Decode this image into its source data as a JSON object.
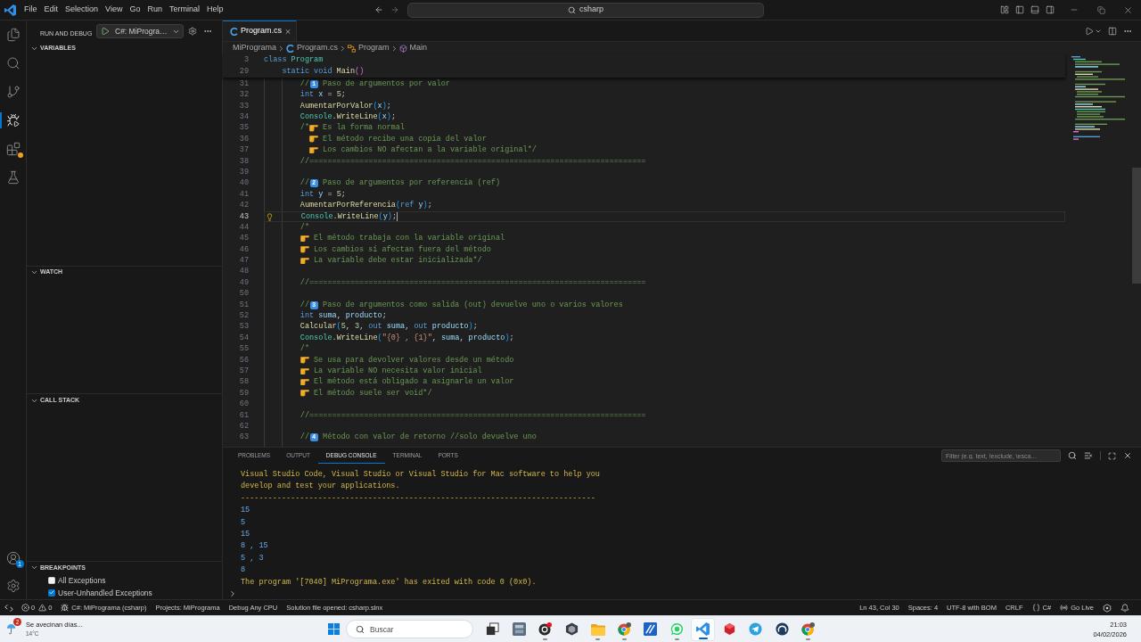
{
  "title_bar": {
    "menu": [
      "File",
      "Edit",
      "Selection",
      "View",
      "Go",
      "Run",
      "Terminal",
      "Help"
    ],
    "command_center": {
      "label": "csharp"
    }
  },
  "activity_bar": {
    "items": [
      {
        "kind": "files",
        "selected": false,
        "warning": false
      },
      {
        "kind": "search",
        "selected": false,
        "warning": false
      },
      {
        "kind": "source-control",
        "selected": false,
        "warning": false
      },
      {
        "kind": "debug",
        "selected": true,
        "warning": false
      },
      {
        "kind": "extensions",
        "selected": false,
        "warning": true
      },
      {
        "kind": "testing",
        "selected": false,
        "warning": false
      }
    ],
    "bottom": [
      {
        "kind": "account",
        "badge": "1"
      },
      {
        "kind": "settings"
      }
    ]
  },
  "sidebar": {
    "title": "RUN AND DEBUG",
    "launch_config": "C#: MiProgra…",
    "sections": [
      {
        "title": "VARIABLES",
        "expanded": true
      },
      {
        "title": "WATCH",
        "expanded": true
      },
      {
        "title": "CALL STACK",
        "expanded": true
      },
      {
        "title": "BREAKPOINTS",
        "expanded": true,
        "items": [
          {
            "label": "All Exceptions",
            "checked": false
          },
          {
            "label": "User-Unhandled Exceptions",
            "checked": true
          }
        ]
      }
    ]
  },
  "editor": {
    "tabs": [
      {
        "label": "Program.cs",
        "selected": true
      }
    ],
    "breadcrumb": [
      {
        "kind": "folder",
        "label": "MiPrograma"
      },
      {
        "kind": "file",
        "label": "Program.cs"
      },
      {
        "kind": "class",
        "label": "Program"
      },
      {
        "kind": "method",
        "label": "Main"
      }
    ],
    "sticky_lines": [
      {
        "number": "3",
        "code": [
          {
            "kind": "keyword",
            "text": "class"
          },
          {
            "kind": "type",
            "text": " Program"
          }
        ],
        "children": [
          {
            "number": "29",
            "code": [
              {
                "kind": "keyword",
                "text": "static"
              },
              {
                "kind": "keyword",
                "text": " void"
              },
              {
                "kind": "method",
                "text": " Main"
              },
              {
                "kind": "bracket2",
                "text": "()"
              }
            ]
          }
        ]
      }
    ],
    "lines": [
      {
        "number": "31",
        "current": false,
        "code": [
          {
            "kind": "comment",
            "text": "//"
          },
          {
            "kind": "keycap",
            "text": "1"
          },
          {
            "kind": "comment",
            "text": " Paso de argumentos por valor"
          }
        ]
      },
      {
        "number": "32",
        "current": false,
        "code": [
          {
            "kind": "keyword",
            "text": "int"
          },
          {
            "kind": "variable",
            "text": " x"
          },
          {
            "kind": "punct",
            "text": " = "
          },
          {
            "kind": "number",
            "text": "5"
          },
          {
            "kind": "punct",
            "text": ";"
          }
        ]
      },
      {
        "number": "33",
        "current": false,
        "code": [
          {
            "kind": "method",
            "text": "AumentarPorValor"
          },
          {
            "kind": "bracket3",
            "text": "("
          },
          {
            "kind": "variable",
            "text": "x"
          },
          {
            "kind": "bracket3",
            "text": ")"
          },
          {
            "kind": "punct",
            "text": ";"
          }
        ]
      },
      {
        "number": "34",
        "current": false,
        "code": [
          {
            "kind": "type",
            "text": "Console"
          },
          {
            "kind": "punct",
            "text": "."
          },
          {
            "kind": "method",
            "text": "WriteLine"
          },
          {
            "kind": "bracket3",
            "text": "("
          },
          {
            "kind": "variable",
            "text": "x"
          },
          {
            "kind": "bracket3",
            "text": ")"
          },
          {
            "kind": "punct",
            "text": ";"
          }
        ]
      },
      {
        "number": "35",
        "current": false,
        "code": [
          {
            "kind": "comment",
            "text": "/*"
          },
          {
            "kind": "hand"
          },
          {
            "kind": "comment",
            "text": " Es la forma normal"
          }
        ],
        "children": [
          {
            "number": "36",
            "current": false,
            "code": [
              {
                "kind": "hand"
              },
              {
                "kind": "comment",
                "text": " El método recibe una copia del valor"
              }
            ]
          },
          {
            "number": "37",
            "current": false,
            "code": [
              {
                "kind": "hand"
              },
              {
                "kind": "comment",
                "text": " Los cambios NO afectan a la variable original*/"
              }
            ]
          }
        ]
      },
      {
        "number": "38",
        "current": false,
        "code": [
          {
            "kind": "comment",
            "text": "//=========================================================================="
          }
        ]
      },
      {
        "number": "39",
        "current": false
      },
      {
        "number": "40",
        "current": false,
        "code": [
          {
            "kind": "comment",
            "text": "//"
          },
          {
            "kind": "keycap",
            "text": "2"
          },
          {
            "kind": "comment",
            "text": " Paso de argumentos por referencia (ref)"
          }
        ]
      },
      {
        "number": "41",
        "current": false,
        "code": [
          {
            "kind": "keyword",
            "text": "int"
          },
          {
            "kind": "variable",
            "text": " y"
          },
          {
            "kind": "punct",
            "text": " = "
          },
          {
            "kind": "number",
            "text": "5"
          },
          {
            "kind": "punct",
            "text": ";"
          }
        ]
      },
      {
        "number": "42",
        "current": false,
        "code": [
          {
            "kind": "method",
            "text": "AumentarPorReferencia"
          },
          {
            "kind": "bracket3",
            "text": "("
          },
          {
            "kind": "keyword",
            "text": "ref"
          },
          {
            "kind": "variable",
            "text": " y"
          },
          {
            "kind": "bracket3",
            "text": ")"
          },
          {
            "kind": "punct",
            "text": ";"
          }
        ]
      },
      {
        "number": "43",
        "current": true,
        "code": [
          {
            "kind": "type",
            "text": "Console"
          },
          {
            "kind": "punct",
            "text": "."
          },
          {
            "kind": "method",
            "text": "WriteLine"
          },
          {
            "kind": "bracket3",
            "text": "("
          },
          {
            "kind": "variable",
            "text": "y"
          },
          {
            "kind": "bracket3",
            "text": ")"
          },
          {
            "kind": "punct",
            "text": ";"
          }
        ]
      },
      {
        "number": "44",
        "current": false,
        "code": [
          {
            "kind": "comment",
            "text": "/*"
          }
        ]
      },
      {
        "number": "45",
        "current": false,
        "code": [
          {
            "kind": "hand"
          },
          {
            "kind": "comment",
            "text": " El método trabaja con la variable original"
          }
        ]
      },
      {
        "number": "46",
        "current": false,
        "code": [
          {
            "kind": "hand"
          },
          {
            "kind": "comment",
            "text": " Los cambios sí afectan fuera del método"
          }
        ]
      },
      {
        "number": "47",
        "current": false,
        "code": [
          {
            "kind": "hand"
          },
          {
            "kind": "comment",
            "text": " La variable debe estar inicializada*/"
          }
        ]
      },
      {
        "number": "48",
        "current": false
      },
      {
        "number": "49",
        "current": false,
        "code": [
          {
            "kind": "comment",
            "text": "//=========================================================================="
          }
        ]
      },
      {
        "number": "50",
        "current": false
      },
      {
        "number": "51",
        "current": false,
        "code": [
          {
            "kind": "comment",
            "text": "//"
          },
          {
            "kind": "keycap",
            "text": "3"
          },
          {
            "kind": "comment",
            "text": " Paso de argumentos como salida (out) devuelve uno o varios valores"
          }
        ]
      },
      {
        "number": "52",
        "current": false,
        "code": [
          {
            "kind": "keyword",
            "text": "int"
          },
          {
            "kind": "variable",
            "text": " suma"
          },
          {
            "kind": "punct",
            "text": ", "
          },
          {
            "kind": "variable",
            "text": "producto"
          },
          {
            "kind": "punct",
            "text": ";"
          }
        ]
      },
      {
        "number": "53",
        "current": false,
        "code": [
          {
            "kind": "method",
            "text": "Calcular"
          },
          {
            "kind": "bracket3",
            "text": "("
          },
          {
            "kind": "number",
            "text": "5"
          },
          {
            "kind": "punct",
            "text": ", "
          },
          {
            "kind": "number",
            "text": "3"
          },
          {
            "kind": "punct",
            "text": ", "
          },
          {
            "kind": "keyword",
            "text": "out"
          },
          {
            "kind": "variable",
            "text": " suma"
          },
          {
            "kind": "punct",
            "text": ", "
          },
          {
            "kind": "keyword",
            "text": "out"
          },
          {
            "kind": "variable",
            "text": " producto"
          },
          {
            "kind": "bracket3",
            "text": ")"
          },
          {
            "kind": "punct",
            "text": ";"
          }
        ]
      },
      {
        "number": "54",
        "current": false,
        "code": [
          {
            "kind": "type",
            "text": "Console"
          },
          {
            "kind": "punct",
            "text": "."
          },
          {
            "kind": "method",
            "text": "WriteLine"
          },
          {
            "kind": "bracket3",
            "text": "("
          },
          {
            "kind": "string",
            "text": "\"{0} , {1}\""
          },
          {
            "kind": "punct",
            "text": ", "
          },
          {
            "kind": "variable",
            "text": "suma"
          },
          {
            "kind": "punct",
            "text": ", "
          },
          {
            "kind": "variable",
            "text": "producto"
          },
          {
            "kind": "bracket3",
            "text": ")"
          },
          {
            "kind": "punct",
            "text": ";"
          }
        ]
      },
      {
        "number": "55",
        "current": false,
        "code": [
          {
            "kind": "comment",
            "text": "/*"
          }
        ]
      },
      {
        "number": "56",
        "current": false,
        "code": [
          {
            "kind": "hand"
          },
          {
            "kind": "comment",
            "text": " Se usa para devolver valores desde un método"
          }
        ]
      },
      {
        "number": "57",
        "current": false,
        "code": [
          {
            "kind": "hand"
          },
          {
            "kind": "comment",
            "text": " La variable NO necesita valor inicial"
          }
        ]
      },
      {
        "number": "58",
        "current": false,
        "code": [
          {
            "kind": "hand"
          },
          {
            "kind": "comment",
            "text": " El método está obligado a asignarle un valor"
          }
        ]
      },
      {
        "number": "59",
        "current": false,
        "code": [
          {
            "kind": "hand"
          },
          {
            "kind": "comment",
            "text": " El método suele ser void*/"
          }
        ]
      },
      {
        "number": "60",
        "current": false
      },
      {
        "number": "61",
        "current": false,
        "code": [
          {
            "kind": "comment",
            "text": "//=========================================================================="
          }
        ]
      },
      {
        "number": "62",
        "current": false
      },
      {
        "number": "63",
        "current": false,
        "code": [
          {
            "kind": "comment",
            "text": "//"
          },
          {
            "kind": "keycap",
            "text": "4"
          },
          {
            "kind": "comment",
            "text": " Método con valor de retorno //solo devuelve uno"
          }
        ]
      }
    ]
  },
  "panel": {
    "tabs": [
      {
        "label": "PROBLEMS",
        "selected": false
      },
      {
        "label": "OUTPUT",
        "selected": false
      },
      {
        "label": "DEBUG CONSOLE",
        "selected": true
      },
      {
        "label": "TERMINAL",
        "selected": false
      },
      {
        "label": "PORTS",
        "selected": false
      }
    ],
    "filter": {
      "placeholder": "Filter (e.g. text, !exclude, \\esca…"
    },
    "console": [
      {
        "kind": "info",
        "text": "Visual Studio Code, Visual Studio or Visual Studio for Mac software to help you"
      },
      {
        "kind": "info",
        "text": "develop and test your applications."
      },
      {
        "kind": "info",
        "text": "------------------------------------------------------------------------------"
      },
      {
        "kind": "stdout",
        "text": "15"
      },
      {
        "kind": "stdout",
        "text": "5"
      },
      {
        "kind": "stdout",
        "text": "15"
      },
      {
        "kind": "stdout",
        "text": "8 , 15"
      },
      {
        "kind": "stdout",
        "text": "5 , 3"
      },
      {
        "kind": "stdout",
        "text": "8"
      },
      {
        "kind": "info",
        "text": "The program '[7040] MiPrograma.exe' has exited with code 0 (0x0)."
      }
    ]
  },
  "status_bar": {
    "left": [
      {
        "kind": "remote"
      },
      {
        "kind": "problems",
        "errors": "0",
        "warnings": "0"
      },
      {
        "kind": "debug",
        "label": "C#: MiPrograma (csharp)"
      },
      {
        "kind": "text",
        "label": "Projects: MiPrograma"
      },
      {
        "kind": "text",
        "label": "Debug Any CPU"
      },
      {
        "kind": "text",
        "label": "Solution file opened: csharp.slnx"
      }
    ],
    "right": [
      {
        "kind": "text",
        "label": "Ln 43, Col 30"
      },
      {
        "kind": "text",
        "label": "Spaces: 4"
      },
      {
        "kind": "text",
        "label": "UTF-8 with BOM"
      },
      {
        "kind": "text",
        "label": "CRLF"
      },
      {
        "kind": "language",
        "label": "C#"
      },
      {
        "kind": "live",
        "label": "Go Live"
      },
      {
        "kind": "extension"
      },
      {
        "kind": "bell"
      }
    ]
  },
  "taskbar": {
    "weather": {
      "badge": "2",
      "headline": "Se avecinan días...",
      "temperature": "14°C"
    },
    "search": {
      "placeholder": "Buscar"
    },
    "apps": [
      {
        "kind": "task-view",
        "running": false,
        "selected": false
      },
      {
        "kind": "tile",
        "running": false,
        "selected": false
      },
      {
        "kind": "dark-circle",
        "running": true,
        "selected": false
      },
      {
        "kind": "cube",
        "running": false,
        "selected": false
      },
      {
        "kind": "folder",
        "running": true,
        "selected": false
      },
      {
        "kind": "browser",
        "running": true,
        "selected": false
      },
      {
        "kind": "blue-tile",
        "running": false,
        "selected": false
      },
      {
        "kind": "chat",
        "running": true,
        "selected": false
      },
      {
        "kind": "editor",
        "running": true,
        "selected": true
      },
      {
        "kind": "red-cube",
        "running": false,
        "selected": false
      },
      {
        "kind": "plane",
        "running": false,
        "selected": false
      },
      {
        "kind": "round",
        "running": false,
        "selected": false
      },
      {
        "kind": "browser",
        "running": true,
        "selected": false
      }
    ],
    "clock": {
      "time": "21:03",
      "date": "04/02/2026"
    }
  }
}
